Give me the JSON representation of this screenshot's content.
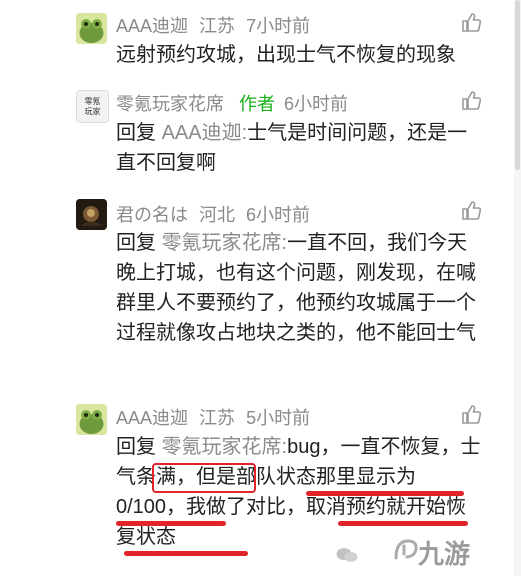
{
  "comments": [
    {
      "username": "AAA迪迦",
      "location": "江苏",
      "time": "7小时前",
      "text": "远射预约攻城，出现士气不恢复的现象"
    },
    {
      "username": "零氪玩家花席",
      "author_tag": "作者",
      "time": "6小时前",
      "avatar_text": "零氪玩家",
      "reply_word": "回复",
      "reply_target": "AAA迪迦:",
      "text": "士气是时间问题，还是一直不回复啊"
    },
    {
      "username": "君の名は",
      "location": "河北",
      "time": "6小时前",
      "reply_word": "回复",
      "reply_target": "零氪玩家花席:",
      "text": "一直不回，我们今天晚上打城，也有这个问题，刚发现，在喊群里人不要预约了，他预约攻城属于一个过程就像攻占地块之类的，他不能回士气"
    },
    {
      "username": "AAA迪迦",
      "location": "江苏",
      "time": "5小时前",
      "reply_word": "回复",
      "reply_target": "零氪玩家花席:",
      "text": "bug，一直不恢复，士气条满，但是部队状态那里显示为0/100，我做了对比，取消预约就开始恢复状态"
    }
  ],
  "watermark": "九游",
  "colors": {
    "meta": "#8a8a8a",
    "author_tag": "#1aad19",
    "highlight": "#e0242a"
  }
}
